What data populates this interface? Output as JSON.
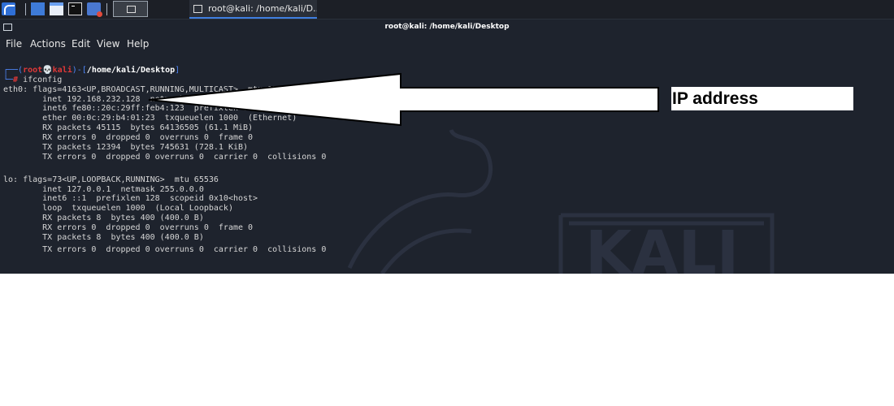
{
  "taskbar": {
    "icons": [
      "kali-menu-icon",
      "desktop-icon",
      "files-icon",
      "terminal-icon",
      "browser-icon",
      "workspace-icon"
    ],
    "task_label": "root@kali: /home/kali/D..."
  },
  "window": {
    "title": "root@kali: /home/kali/Desktop",
    "menu": [
      "File",
      "Actions",
      "Edit",
      "View",
      "Help"
    ]
  },
  "prompt": {
    "open": "┌──(",
    "user": "root",
    "skull": "💀",
    "host": "kali",
    "mid": ")-[",
    "path": "/home/kali/Desktop",
    "close": "]",
    "cmd_prefix": "└─",
    "hash": "#",
    "command": "ifconfig"
  },
  "output": [
    "eth0: flags=4163<UP,BROADCAST,RUNNING,MULTICAST>  mtu 1500",
    "        inet 192.168.232.128  netmask 255.255.255.0  broadcast 192.168.232.255",
    "        inet6 fe80::20c:29ff:feb4:123  prefixlen 64  scopeid 0x20<link>",
    "        ether 00:0c:29:b4:01:23  txqueuelen 1000  (Ethernet)",
    "        RX packets 45115  bytes 64136505 (61.1 MiB)",
    "        RX errors 0  dropped 0  overruns 0  frame 0",
    "        TX packets 12394  bytes 745631 (728.1 KiB)",
    "        TX errors 0  dropped 0 overruns 0  carrier 0  collisions 0",
    "",
    "lo: flags=73<UP,LOOPBACK,RUNNING>  mtu 65536",
    "        inet 127.0.0.1  netmask 255.0.0.0",
    "        inet6 ::1  prefixlen 128  scopeid 0x10<host>",
    "        loop  txqueuelen 1000  (Local Loopback)",
    "        RX packets 8  bytes 400 (400.0 B)",
    "        RX errors 0  dropped 0  overruns 0  frame 0",
    "        TX packets 8  bytes 400 (400.0 B)",
    "        TX errors 0  dropped 0 overruns 0  carrier 0  collisions 0"
  ],
  "watermark": {
    "text": "KALI"
  },
  "annotation": {
    "label": "IP address"
  }
}
